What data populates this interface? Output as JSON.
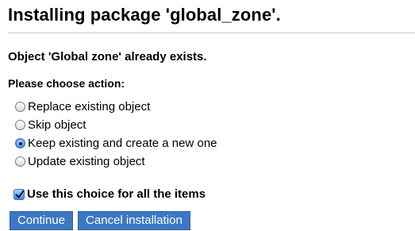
{
  "header": {
    "title": "Installing package 'global_zone'."
  },
  "message": {
    "text": "Object 'Global zone' already exists."
  },
  "actions": {
    "label": "Please choose action:",
    "options": [
      {
        "label": "Replace existing object",
        "selected": false
      },
      {
        "label": "Skip object",
        "selected": false
      },
      {
        "label": "Keep existing and create a new one",
        "selected": true
      },
      {
        "label": "Update existing object",
        "selected": false
      }
    ]
  },
  "apply_all": {
    "label": "Use this choice for all the items",
    "checked": true
  },
  "buttons": {
    "continue_label": "Continue",
    "cancel_label": "Cancel installation"
  },
  "colors": {
    "button_bg": "#3a78c3",
    "button_text": "#ffffff",
    "accent": "#4a8ee6"
  }
}
